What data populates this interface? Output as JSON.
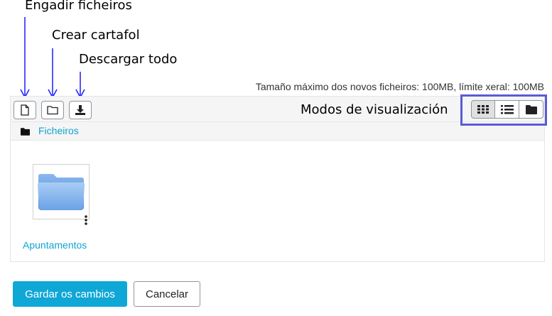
{
  "annotations": {
    "add_files": "Engadir ficheiros",
    "create_folder": "Crear cartafol",
    "download_all": "Descargar todo",
    "view_modes": "Modos de visualización"
  },
  "max_size_text": "Tamaño máximo dos novos ficheiros: 100MB, límite xeral: 100MB",
  "toolbar": {
    "buttons": [
      {
        "icon": "file-icon"
      },
      {
        "icon": "folder-outline-icon"
      },
      {
        "icon": "download-icon"
      }
    ],
    "view_modes": [
      {
        "icon": "grid-icon",
        "active": true
      },
      {
        "icon": "list-icon",
        "active": false
      },
      {
        "icon": "folder-solid-icon",
        "active": false
      }
    ]
  },
  "breadcrumb": {
    "label": "Ficheiros"
  },
  "files": [
    {
      "name": "Apuntamentos",
      "icon": "folder-icon"
    }
  ],
  "actions": {
    "save_label": "Gardar os cambios",
    "cancel_label": "Cancelar"
  },
  "colors": {
    "link": "#0ea5d0",
    "primary": "#0fa7d6",
    "annotation_arrow": "#1a1aff",
    "highlight_border": "#5b5bd6"
  }
}
